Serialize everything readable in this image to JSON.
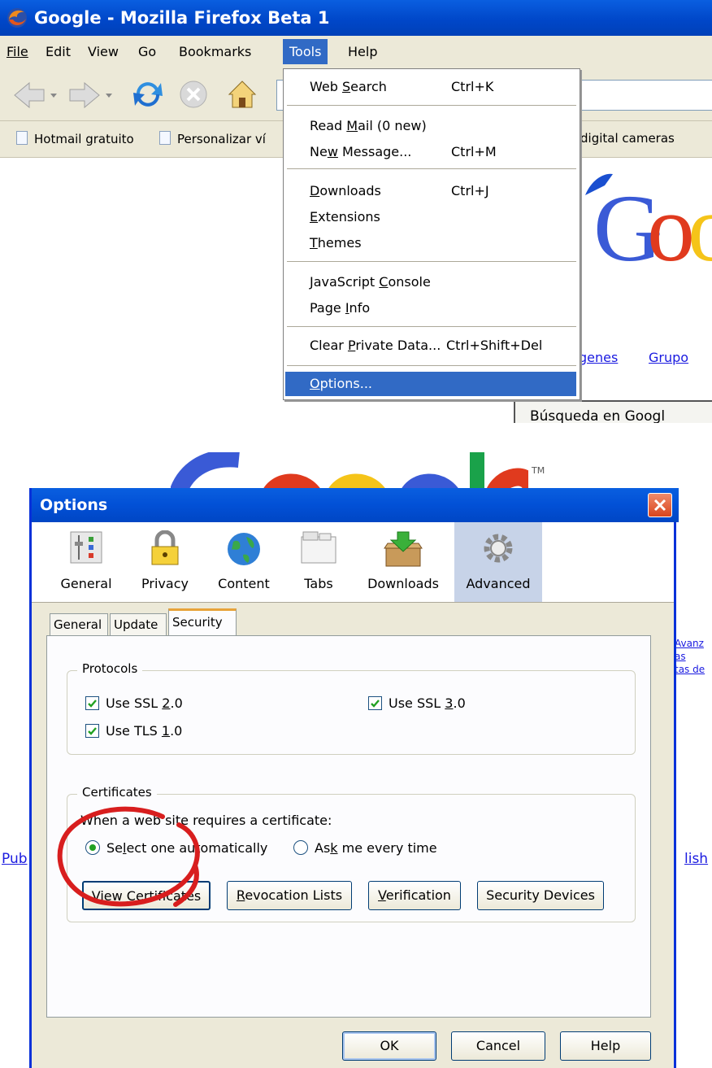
{
  "browser": {
    "window_title": "Google - Mozilla Firefox Beta 1",
    "menu": [
      "File",
      "Edit",
      "View",
      "Go",
      "Bookmarks",
      "Tools",
      "Help"
    ],
    "bookmarks": [
      "Hotmail gratuito",
      "Personalizar ví",
      "digital cameras"
    ],
    "page_links": [
      "genes",
      "Grupo"
    ],
    "search_button_fragment": "Búsqueda en Googl",
    "tools_menu": {
      "items": [
        {
          "label": "Web Search",
          "shortcut": "Ctrl+K"
        },
        {
          "label": "Read Mail (0 new)",
          "shortcut": ""
        },
        {
          "label": "New Message...",
          "shortcut": "Ctrl+M"
        },
        {
          "label": "Downloads",
          "shortcut": "Ctrl+J"
        },
        {
          "label": "Extensions",
          "shortcut": ""
        },
        {
          "label": "Themes",
          "shortcut": ""
        },
        {
          "label": "JavaScript Console",
          "shortcut": ""
        },
        {
          "label": "Page Info",
          "shortcut": ""
        },
        {
          "label": "Clear Private Data...",
          "shortcut": "Ctrl+Shift+Del"
        },
        {
          "label": "Options...",
          "shortcut": ""
        }
      ]
    }
  },
  "background": {
    "tm": "TM",
    "right_links": [
      "Avanz",
      "as",
      "tas de"
    ],
    "left_link": "Pub",
    "right_link": "lish"
  },
  "dialog": {
    "title": "Options",
    "panes": [
      "General",
      "Privacy",
      "Content",
      "Tabs",
      "Downloads",
      "Advanced"
    ],
    "selected_pane": "Advanced",
    "tabs": [
      "General",
      "Update",
      "Security"
    ],
    "selected_tab": "Security",
    "protocols": {
      "title": "Protocols",
      "ssl2": {
        "label": "Use SSL 2.0",
        "checked": true
      },
      "ssl3": {
        "label": "Use SSL 3.0",
        "checked": true
      },
      "tls1": {
        "label": "Use TLS 1.0",
        "checked": true
      }
    },
    "certificates": {
      "title": "Certificates",
      "prompt": "When a web site requires a certificate:",
      "radio_auto": {
        "label": "Select one automatically",
        "selected": true
      },
      "radio_ask": {
        "label": "Ask me every time",
        "selected": false
      },
      "buttons": [
        "View Certificates",
        "Revocation Lists",
        "Verification",
        "Security Devices"
      ]
    },
    "footer": {
      "ok": "OK",
      "cancel": "Cancel",
      "help": "Help"
    }
  },
  "annotation_color": "#d81e1e"
}
